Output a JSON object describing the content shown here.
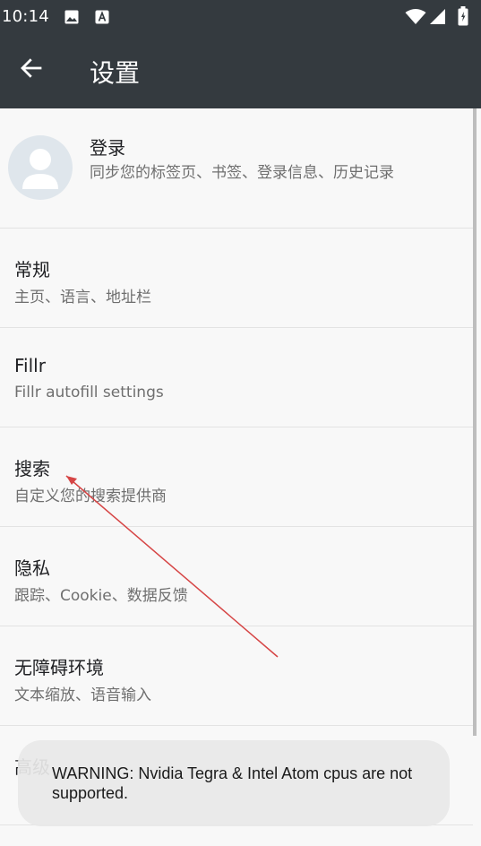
{
  "status_bar": {
    "time": "10:14",
    "icons": [
      "image-icon",
      "a-notification-icon",
      "wifi-icon",
      "signal-icon",
      "battery-icon"
    ]
  },
  "toolbar": {
    "back_icon": "arrow-left-icon",
    "title": "设置"
  },
  "settings": [
    {
      "id": "login",
      "title": "登录",
      "subtitle": "同步您的标签页、书签、登录信息、历史记录"
    },
    {
      "id": "general",
      "title": "常规",
      "subtitle": "主页、语言、地址栏"
    },
    {
      "id": "fillr",
      "title": "Fillr",
      "subtitle": "Fillr autofill settings"
    },
    {
      "id": "search",
      "title": "搜索",
      "subtitle": "自定义您的搜索提供商"
    },
    {
      "id": "privacy",
      "title": "隐私",
      "subtitle": "跟踪、Cookie、数据反馈"
    },
    {
      "id": "accessibility",
      "title": "无障碍环境",
      "subtitle": "文本缩放、语音输入"
    },
    {
      "id": "advanced",
      "title": "高级"
    }
  ],
  "toast": {
    "message": "WARNING: Nvidia Tegra & Intel Atom cpus are not supported."
  },
  "colors": {
    "toolbar": "#343a3f",
    "background": "#f8f8f8",
    "annotation_arrow": "#d64545"
  }
}
